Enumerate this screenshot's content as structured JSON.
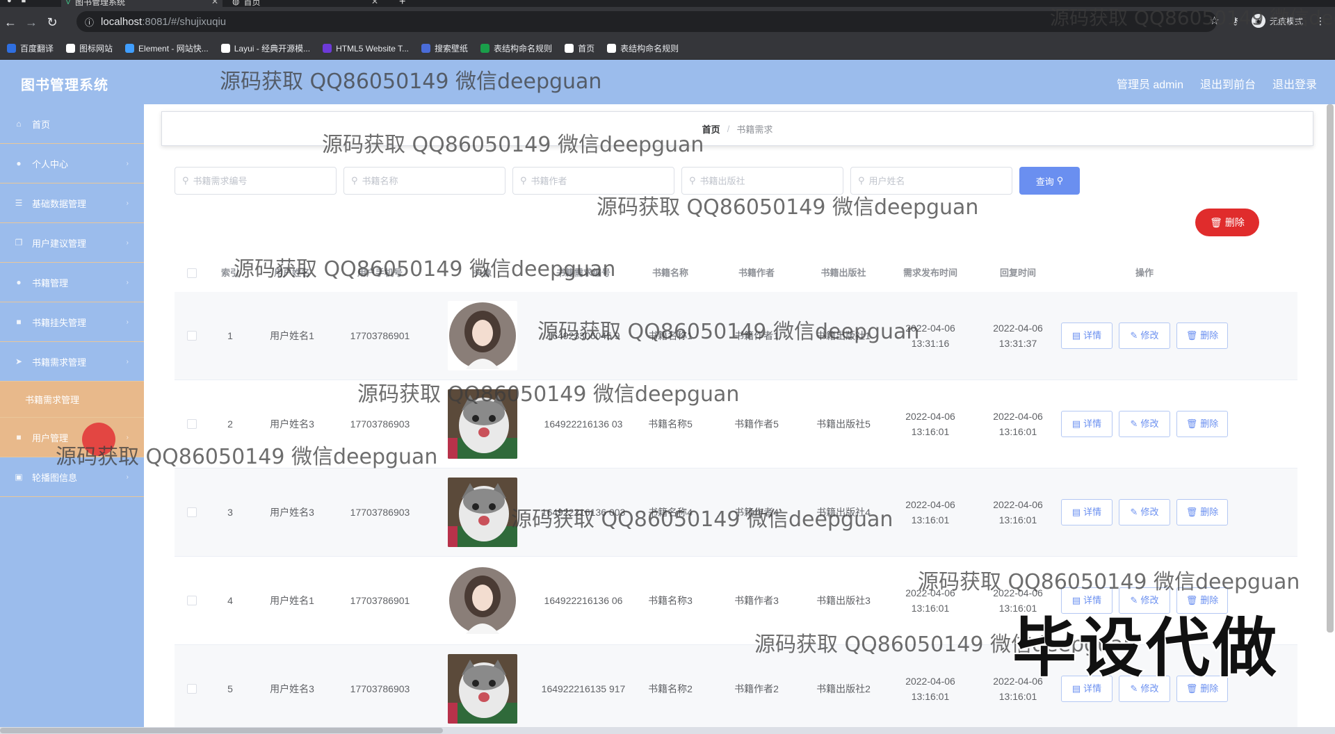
{
  "browser": {
    "tabs": [
      {
        "title": "图书管理系统",
        "active": true
      },
      {
        "title": "首页",
        "active": false
      }
    ],
    "url_host": "localhost",
    "url_path": ":8081/#/shujixuqiu",
    "incognito_label": "无痕模式",
    "bookmarks": [
      {
        "label": "百度翻译",
        "color": "#2f6fe0"
      },
      {
        "label": "图标网站",
        "color": "#ffffff"
      },
      {
        "label": "Element - 网站快...",
        "color": "#409eff"
      },
      {
        "label": "Layui - 经典开源模...",
        "color": "#ffffff"
      },
      {
        "label": "HTML5 Website T...",
        "color": "#6d3ad8"
      },
      {
        "label": "搜索壁纸",
        "color": "#4a6cd8"
      },
      {
        "label": "表结构命名规则",
        "color": "#1a9e4a"
      },
      {
        "label": "首页",
        "color": "#ffffff"
      },
      {
        "label": "表结构命名规则",
        "color": "#ffffff"
      }
    ]
  },
  "header": {
    "title": "图书管理系统",
    "admin": "管理员 admin",
    "to_front": "退出到前台",
    "logout": "退出登录"
  },
  "sidebar": {
    "items": [
      {
        "label": "首页",
        "icon": "home-icon"
      },
      {
        "label": "个人中心",
        "icon": "user-icon"
      },
      {
        "label": "基础数据管理",
        "icon": "database-icon"
      },
      {
        "label": "用户建议管理",
        "icon": "copy-icon"
      },
      {
        "label": "书籍管理",
        "icon": "book-icon"
      },
      {
        "label": "书籍挂失管理",
        "icon": "box-icon"
      },
      {
        "label": "书籍需求管理",
        "icon": "send-icon"
      },
      {
        "label": "书籍需求管理",
        "icon": "none",
        "sub": true
      },
      {
        "label": "用户管理",
        "icon": "users-icon"
      },
      {
        "label": "轮播图信息",
        "icon": "image-icon"
      }
    ]
  },
  "breadcrumb": {
    "home": "首页",
    "separator": "/",
    "current": "书籍需求"
  },
  "search": {
    "placeholders": [
      "书籍需求编号",
      "书籍名称",
      "书籍作者",
      "书籍出版社",
      "用户姓名"
    ],
    "query_label": "查询",
    "delete_label": "删除"
  },
  "table": {
    "headers": [
      "索引",
      "用户姓名",
      "用户手机号",
      "头像",
      "书籍需求编号",
      "书籍名称",
      "书籍作者",
      "书籍出版社",
      "需求发布时间",
      "回复时间",
      "操作"
    ],
    "ops": {
      "detail": "详情",
      "edit": "修改",
      "delete": "删除"
    },
    "rows": [
      {
        "idx": "1",
        "name": "用户姓名1",
        "phone": "17703786901",
        "avatar": "girl",
        "code": "164923306045 9",
        "book": "书籍名称1",
        "author": "书籍作者1",
        "pub": "书籍出版社1",
        "t1": "2022-04-06 13:31:16",
        "t2": "2022-04-06 13:31:37"
      },
      {
        "idx": "2",
        "name": "用户姓名3",
        "phone": "17703786903",
        "avatar": "cat",
        "code": "164922216136 03",
        "book": "书籍名称5",
        "author": "书籍作者5",
        "pub": "书籍出版社5",
        "t1": "2022-04-06 13:16:01",
        "t2": "2022-04-06 13:16:01"
      },
      {
        "idx": "3",
        "name": "用户姓名3",
        "phone": "17703786903",
        "avatar": "cat",
        "code": "164922216136 003",
        "book": "书籍名称4",
        "author": "书籍作者4",
        "pub": "书籍出版社4",
        "t1": "2022-04-06 13:16:01",
        "t2": "2022-04-06 13:16:01"
      },
      {
        "idx": "4",
        "name": "用户姓名1",
        "phone": "17703786901",
        "avatar": "girl",
        "code": "164922216136 06",
        "book": "书籍名称3",
        "author": "书籍作者3",
        "pub": "书籍出版社3",
        "t1": "2022-04-06 13:16:01",
        "t2": "2022-04-06 13:16:01"
      },
      {
        "idx": "5",
        "name": "用户姓名3",
        "phone": "17703786903",
        "avatar": "cat",
        "code": "164922216135 917",
        "book": "书籍名称2",
        "author": "书籍作者2",
        "pub": "书籍出版社2",
        "t1": "2022-04-06 13:16:01",
        "t2": "2022-04-06 13:16:01"
      }
    ]
  },
  "watermark": {
    "text": "源码获取 QQ86050149 微信deepguan",
    "badge": "毕设代做"
  }
}
